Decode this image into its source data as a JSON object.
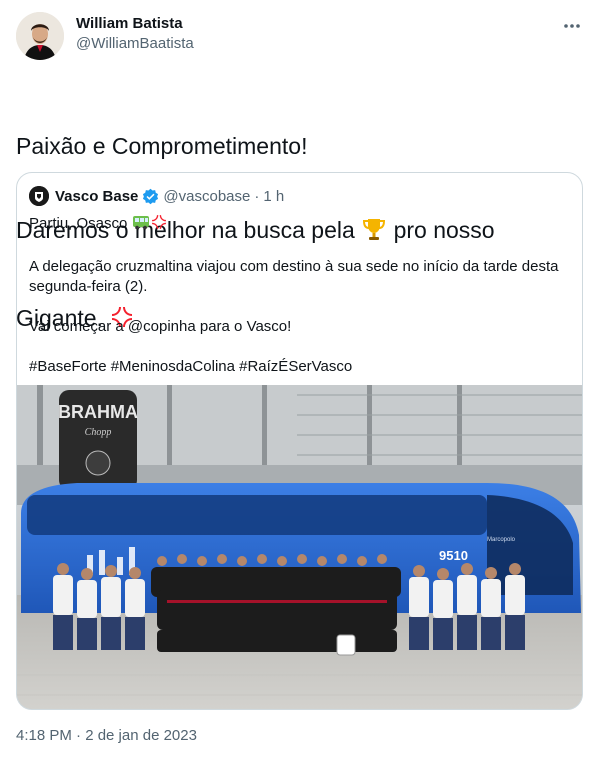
{
  "author": {
    "display_name": "William Batista",
    "handle": "@WilliamBaatista"
  },
  "tweet": {
    "line1": "Paixão e Comprometimento!",
    "line2_before": "Daremos o melhor na busca pela ",
    "line2_emoji": "trophy-icon",
    "line2_after": " pro nosso",
    "line3": "Gigante. ",
    "line3_emoji": "anger-symbol-icon"
  },
  "quoted": {
    "display_name": "Vasco Base",
    "handle": "@vascobase",
    "separator": "·",
    "time": "1 h",
    "p1": "Partiu, Osasco ",
    "p1_emojis": [
      "bus-icon",
      "anger-symbol-icon"
    ],
    "p2": "A delegação cruzmaltina viajou com destino à sua sede no início da tarde desta segunda-feira (2).",
    "p3": "Vai começar a @copinha para o Vasco!",
    "p4": "#BaseForte #MeninosdaColina #RaízÉSerVasco",
    "photo": {
      "banner_text": "BRAHMA",
      "banner_sub": "Chopp",
      "bus_number": "9510",
      "bus_brand": "Marcopolo"
    }
  },
  "timestamp": "4:18 PM · 2 de jan de 2023",
  "colors": {
    "text": "#0f1419",
    "muted": "#536471",
    "border": "#cfd9de",
    "verified": "#1d9bf0",
    "anger": "#f4212e",
    "bus_blue": "#2f6fd6"
  }
}
